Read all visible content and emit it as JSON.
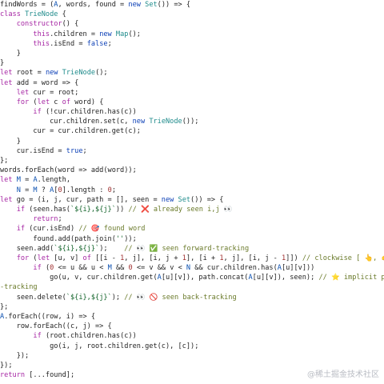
{
  "code_lines": [
    [
      [
        "default",
        "findWords = ("
      ],
      [
        "var",
        "A"
      ],
      [
        "default",
        ", words, found = "
      ],
      [
        "kwb",
        "new"
      ],
      [
        "default",
        " "
      ],
      [
        "cls",
        "Set"
      ],
      [
        "default",
        "()) => {"
      ]
    ],
    [
      [
        "kw",
        "class"
      ],
      [
        "default",
        " "
      ],
      [
        "cls",
        "TrieNode"
      ],
      [
        "default",
        " {"
      ]
    ],
    [
      [
        "default",
        "    "
      ],
      [
        "kw",
        "constructor"
      ],
      [
        "default",
        "() {"
      ]
    ],
    [
      [
        "default",
        "        "
      ],
      [
        "kw",
        "this"
      ],
      [
        "default",
        ".children = "
      ],
      [
        "kwb",
        "new"
      ],
      [
        "default",
        " "
      ],
      [
        "cls",
        "Map"
      ],
      [
        "default",
        "();"
      ]
    ],
    [
      [
        "default",
        "        "
      ],
      [
        "kw",
        "this"
      ],
      [
        "default",
        ".isEnd = "
      ],
      [
        "kwb",
        "false"
      ],
      [
        "default",
        ";"
      ]
    ],
    [
      [
        "default",
        "    }"
      ]
    ],
    [
      [
        "default",
        "}"
      ]
    ],
    [
      [
        "kw",
        "let"
      ],
      [
        "default",
        " root = "
      ],
      [
        "kwb",
        "new"
      ],
      [
        "default",
        " "
      ],
      [
        "cls",
        "TrieNode"
      ],
      [
        "default",
        "();"
      ]
    ],
    [
      [
        "kw",
        "let"
      ],
      [
        "default",
        " add = word => {"
      ]
    ],
    [
      [
        "default",
        "    "
      ],
      [
        "kw",
        "let"
      ],
      [
        "default",
        " cur = root;"
      ]
    ],
    [
      [
        "default",
        "    "
      ],
      [
        "kw",
        "for"
      ],
      [
        "default",
        " ("
      ],
      [
        "kw",
        "let"
      ],
      [
        "default",
        " c "
      ],
      [
        "kw",
        "of"
      ],
      [
        "default",
        " word) {"
      ]
    ],
    [
      [
        "default",
        "        "
      ],
      [
        "kw",
        "if"
      ],
      [
        "default",
        " (!cur.children.has(c))"
      ]
    ],
    [
      [
        "default",
        "            cur.children."
      ],
      [
        "fn",
        "set"
      ],
      [
        "default",
        "(c, "
      ],
      [
        "kwb",
        "new"
      ],
      [
        "default",
        " "
      ],
      [
        "cls",
        "TrieNode"
      ],
      [
        "default",
        "());"
      ]
    ],
    [
      [
        "default",
        "        cur = cur.children."
      ],
      [
        "fn",
        "get"
      ],
      [
        "default",
        "(c);"
      ]
    ],
    [
      [
        "default",
        "    }"
      ]
    ],
    [
      [
        "default",
        "    cur.isEnd = "
      ],
      [
        "kwb",
        "true"
      ],
      [
        "default",
        ";"
      ]
    ],
    [
      [
        "default",
        "};"
      ]
    ],
    [
      [
        "default",
        "words.forEach(word => add(word));"
      ]
    ],
    [
      [
        "kw",
        "let"
      ],
      [
        "default",
        " "
      ],
      [
        "var",
        "M"
      ],
      [
        "default",
        " = "
      ],
      [
        "var",
        "A"
      ],
      [
        "default",
        ".length,"
      ]
    ],
    [
      [
        "default",
        "    "
      ],
      [
        "var",
        "N"
      ],
      [
        "default",
        " = "
      ],
      [
        "var",
        "M"
      ],
      [
        "default",
        " ? "
      ],
      [
        "var",
        "A"
      ],
      [
        "default",
        "["
      ],
      [
        "num",
        "0"
      ],
      [
        "default",
        "].length : "
      ],
      [
        "num",
        "0"
      ],
      [
        "default",
        ";"
      ]
    ],
    [
      [
        "kw",
        "let"
      ],
      [
        "default",
        " go = (i, j, cur, path = [], seen = "
      ],
      [
        "kwb",
        "new"
      ],
      [
        "default",
        " "
      ],
      [
        "cls",
        "Set"
      ],
      [
        "default",
        "()) => {"
      ]
    ],
    [
      [
        "default",
        "    "
      ],
      [
        "kw",
        "if"
      ],
      [
        "default",
        " (seen.has("
      ],
      [
        "str",
        "`${i},${j}`"
      ],
      [
        "default",
        ")) "
      ],
      [
        "com",
        "// ❌ already seen i,j 👀"
      ]
    ],
    [
      [
        "default",
        "        "
      ],
      [
        "kw",
        "return"
      ],
      [
        "default",
        ";"
      ]
    ],
    [
      [
        "default",
        "    "
      ],
      [
        "kw",
        "if"
      ],
      [
        "default",
        " (cur.isEnd) "
      ],
      [
        "com",
        "// 🎯 found word"
      ]
    ],
    [
      [
        "default",
        "        found.add(path.join("
      ],
      [
        "str",
        "''"
      ],
      [
        "default",
        "));"
      ]
    ],
    [
      [
        "default",
        "    seen.add("
      ],
      [
        "str",
        "`${i},${j}`"
      ],
      [
        "default",
        ");    "
      ],
      [
        "com",
        "// 👀 ✅ seen forward-tracking"
      ]
    ],
    [
      [
        "default",
        "    "
      ],
      [
        "kw",
        "for"
      ],
      [
        "default",
        " ("
      ],
      [
        "kw",
        "let"
      ],
      [
        "default",
        " [u, v] "
      ],
      [
        "kw",
        "of"
      ],
      [
        "default",
        " [[i - "
      ],
      [
        "num",
        "1"
      ],
      [
        "default",
        ", j], [i, j + "
      ],
      [
        "num",
        "1"
      ],
      [
        "default",
        "], [i + "
      ],
      [
        "num",
        "1"
      ],
      [
        "default",
        ", j], [i, j - "
      ],
      [
        "num",
        "1"
      ],
      [
        "default",
        "]]) "
      ],
      [
        "com",
        "// clockwise [ 👆, 👉, 👇, 👈 ]"
      ]
    ],
    [
      [
        "default",
        "        "
      ],
      [
        "kw",
        "if"
      ],
      [
        "default",
        " ("
      ],
      [
        "num",
        "0"
      ],
      [
        "default",
        " <= u && u < "
      ],
      [
        "var",
        "M"
      ],
      [
        "default",
        " && "
      ],
      [
        "num",
        "0"
      ],
      [
        "default",
        " <= v && v < "
      ],
      [
        "var",
        "N"
      ],
      [
        "default",
        " && cur.children.has("
      ],
      [
        "var",
        "A"
      ],
      [
        "default",
        "[u][v]))"
      ]
    ],
    [
      [
        "default",
        "            go(u, v, cur.children."
      ],
      [
        "fn",
        "get"
      ],
      [
        "default",
        "("
      ],
      [
        "var",
        "A"
      ],
      [
        "default",
        "[u][v]), path.concat("
      ],
      [
        "var",
        "A"
      ],
      [
        "default",
        "[u][v]), seen); "
      ],
      [
        "com",
        "// ⭐ implicit path forward"
      ]
    ],
    [
      [
        "com",
        "-tracking"
      ]
    ],
    [
      [
        "default",
        "    seen.delete("
      ],
      [
        "str",
        "`${i},${j}`"
      ],
      [
        "default",
        "); "
      ],
      [
        "com",
        "// 👀 🚫 seen back-tracking"
      ]
    ],
    [
      [
        "default",
        "};"
      ]
    ],
    [
      [
        "var",
        "A"
      ],
      [
        "default",
        ".forEach((row, i) => {"
      ]
    ],
    [
      [
        "default",
        "    row.forEach((c, j) => {"
      ]
    ],
    [
      [
        "default",
        "        "
      ],
      [
        "kw",
        "if"
      ],
      [
        "default",
        " (root.children.has(c))"
      ]
    ],
    [
      [
        "default",
        "            go(i, j, root.children."
      ],
      [
        "fn",
        "get"
      ],
      [
        "default",
        "(c), [c]);"
      ]
    ],
    [
      [
        "default",
        "    });"
      ]
    ],
    [
      [
        "default",
        "});"
      ]
    ],
    [
      [
        "kw",
        "return"
      ],
      [
        "default",
        " [...found];"
      ]
    ]
  ],
  "watermark": "@稀土掘金技术社区",
  "colors": {
    "background": "#ffffff",
    "keyword": "#a626a4",
    "keyword_value": "#0b3fb6",
    "class_name": "#1e8b8b",
    "string": "#116329",
    "number": "#a03030",
    "comment": "#6a7a2a"
  }
}
